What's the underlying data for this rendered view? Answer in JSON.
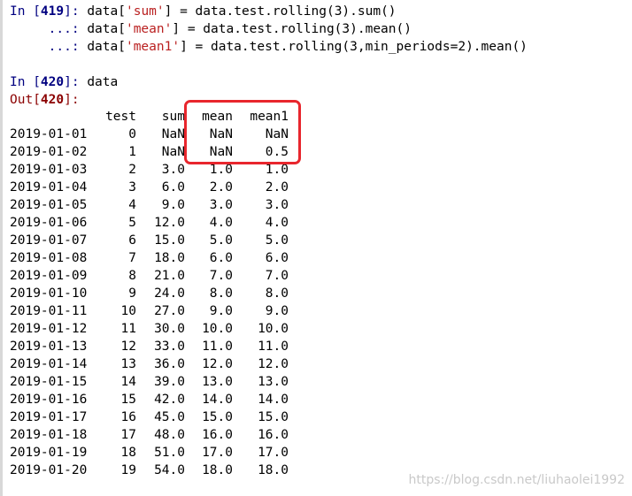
{
  "cell419": {
    "prompt": {
      "pre": "In [",
      "num": "419",
      "post": "]:"
    },
    "lines": [
      {
        "a": "data[",
        "s": "'sum'",
        "b": "] = data.test.rolling(3).sum()"
      },
      {
        "a": "data[",
        "s": "'mean'",
        "b": "] = data.test.rolling(3).mean()"
      },
      {
        "a": "data[",
        "s": "'mean1'",
        "b": "] = data.test.rolling(3,min_periods=2).mean()"
      }
    ],
    "cont": "...:"
  },
  "cell420": {
    "prompt": {
      "pre": "In [",
      "num": "420",
      "post": "]:"
    },
    "code": "data",
    "out": {
      "pre": "Out[",
      "num": "420",
      "post": "]:"
    }
  },
  "table": {
    "columns": [
      "test",
      "sum",
      "mean",
      "mean1"
    ],
    "rows": [
      [
        "2019-01-01",
        "0",
        "NaN",
        "NaN",
        "NaN"
      ],
      [
        "2019-01-02",
        "1",
        "NaN",
        "NaN",
        "0.5"
      ],
      [
        "2019-01-03",
        "2",
        "3.0",
        "1.0",
        "1.0"
      ],
      [
        "2019-01-04",
        "3",
        "6.0",
        "2.0",
        "2.0"
      ],
      [
        "2019-01-05",
        "4",
        "9.0",
        "3.0",
        "3.0"
      ],
      [
        "2019-01-06",
        "5",
        "12.0",
        "4.0",
        "4.0"
      ],
      [
        "2019-01-07",
        "6",
        "15.0",
        "5.0",
        "5.0"
      ],
      [
        "2019-01-08",
        "7",
        "18.0",
        "6.0",
        "6.0"
      ],
      [
        "2019-01-09",
        "8",
        "21.0",
        "7.0",
        "7.0"
      ],
      [
        "2019-01-10",
        "9",
        "24.0",
        "8.0",
        "8.0"
      ],
      [
        "2019-01-11",
        "10",
        "27.0",
        "9.0",
        "9.0"
      ],
      [
        "2019-01-12",
        "11",
        "30.0",
        "10.0",
        "10.0"
      ],
      [
        "2019-01-13",
        "12",
        "33.0",
        "11.0",
        "11.0"
      ],
      [
        "2019-01-14",
        "13",
        "36.0",
        "12.0",
        "12.0"
      ],
      [
        "2019-01-15",
        "14",
        "39.0",
        "13.0",
        "13.0"
      ],
      [
        "2019-01-16",
        "15",
        "42.0",
        "14.0",
        "14.0"
      ],
      [
        "2019-01-17",
        "16",
        "45.0",
        "15.0",
        "15.0"
      ],
      [
        "2019-01-18",
        "17",
        "48.0",
        "16.0",
        "16.0"
      ],
      [
        "2019-01-19",
        "18",
        "51.0",
        "17.0",
        "17.0"
      ],
      [
        "2019-01-20",
        "19",
        "54.0",
        "18.0",
        "18.0"
      ]
    ]
  },
  "colors": {
    "highlight": "#e8262d",
    "in_prompt": "#000080",
    "out_prompt": "#8b0000",
    "string": "#ba2121"
  },
  "watermark": "https://blog.csdn.net/liuhaolei1992"
}
